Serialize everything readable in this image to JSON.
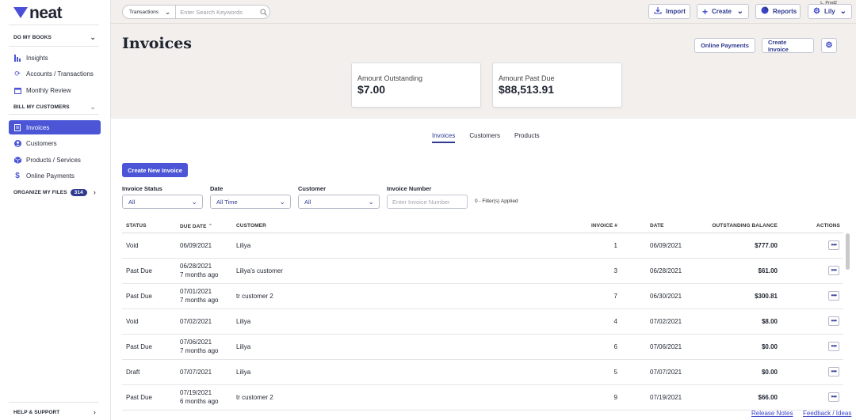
{
  "sidebar": {
    "logo_text": "neat",
    "sections": {
      "do_my_books": "DO MY BOOKS",
      "bill_my_customers": "BILL MY CUSTOMERS",
      "organize_my_files": "ORGANIZE MY FILES",
      "help_support": "HELP & SUPPORT"
    },
    "organize_badge": "314",
    "items": [
      {
        "label": "Insights",
        "icon": "bar-chart-icon"
      },
      {
        "label": "Accounts / Transactions",
        "icon": "sync-icon"
      },
      {
        "label": "Monthly Review",
        "icon": "calendar-icon"
      },
      {
        "label": "Invoices",
        "icon": "invoice-icon",
        "active": true
      },
      {
        "label": "Customers",
        "icon": "user-icon"
      },
      {
        "label": "Products / Services",
        "icon": "box-icon"
      },
      {
        "label": "Online Payments",
        "icon": "dollar-icon"
      }
    ]
  },
  "topbar": {
    "search_scope": "Transactions",
    "search_placeholder": "Enter Search Keywords",
    "import_label": "Import",
    "create_label": "Create",
    "reports_label": "Reports",
    "user_label": "Lily",
    "user_tag": "L. Prod2"
  },
  "header": {
    "title": "Invoices",
    "online_payments_label": "Online Payments",
    "create_invoice_label": "Create Invoice"
  },
  "stats": {
    "outstanding_label": "Amount Outstanding",
    "outstanding_value": "$7.00",
    "past_due_label": "Amount Past Due",
    "past_due_value": "$88,513.91"
  },
  "tabs": [
    "Invoices",
    "Customers",
    "Products"
  ],
  "create_new_label": "Create New Invoice",
  "filters": {
    "status_label": "Invoice Status",
    "status_value": "All",
    "date_label": "Date",
    "date_value": "All Time",
    "customer_label": "Customer",
    "customer_value": "All",
    "number_label": "Invoice Number",
    "number_placeholder": "Enter Invoice Number",
    "applied_text": "0 - Filter(s) Applied"
  },
  "table": {
    "headers": {
      "status": "STATUS",
      "due_date": "DUE DATE",
      "customer": "CUSTOMER",
      "invoice_no": "INVOICE #",
      "date": "DATE",
      "balance": "OUTSTANDING BALANCE",
      "actions": "ACTIONS"
    },
    "rows": [
      {
        "status": "Void",
        "due": "06/09/2021",
        "ago": "",
        "customer": "Liliya",
        "number": "1",
        "date": "06/09/2021",
        "balance": "$777.00"
      },
      {
        "status": "Past Due",
        "due": "06/28/2021",
        "ago": "7 months ago",
        "customer": "Liliya's customer",
        "number": "3",
        "date": "06/28/2021",
        "balance": "$61.00"
      },
      {
        "status": "Past Due",
        "due": "07/01/2021",
        "ago": "7 months ago",
        "customer": "tr customer 2",
        "number": "7",
        "date": "06/30/2021",
        "balance": "$300.81"
      },
      {
        "status": "Void",
        "due": "07/02/2021",
        "ago": "",
        "customer": "Liliya",
        "number": "4",
        "date": "07/02/2021",
        "balance": "$8.00"
      },
      {
        "status": "Past Due",
        "due": "07/06/2021",
        "ago": "7 months ago",
        "customer": "Liliya",
        "number": "6",
        "date": "07/06/2021",
        "balance": "$0.00"
      },
      {
        "status": "Draft",
        "due": "07/07/2021",
        "ago": "",
        "customer": "Liliya",
        "number": "5",
        "date": "07/07/2021",
        "balance": "$0.00"
      },
      {
        "status": "Past Due",
        "due": "07/19/2021",
        "ago": "6 months ago",
        "customer": "tr customer 2",
        "number": "9",
        "date": "07/19/2021",
        "balance": "$66.00"
      }
    ]
  },
  "footer": {
    "release_notes": "Release Notes",
    "feedback": "Feedback / Ideas"
  }
}
